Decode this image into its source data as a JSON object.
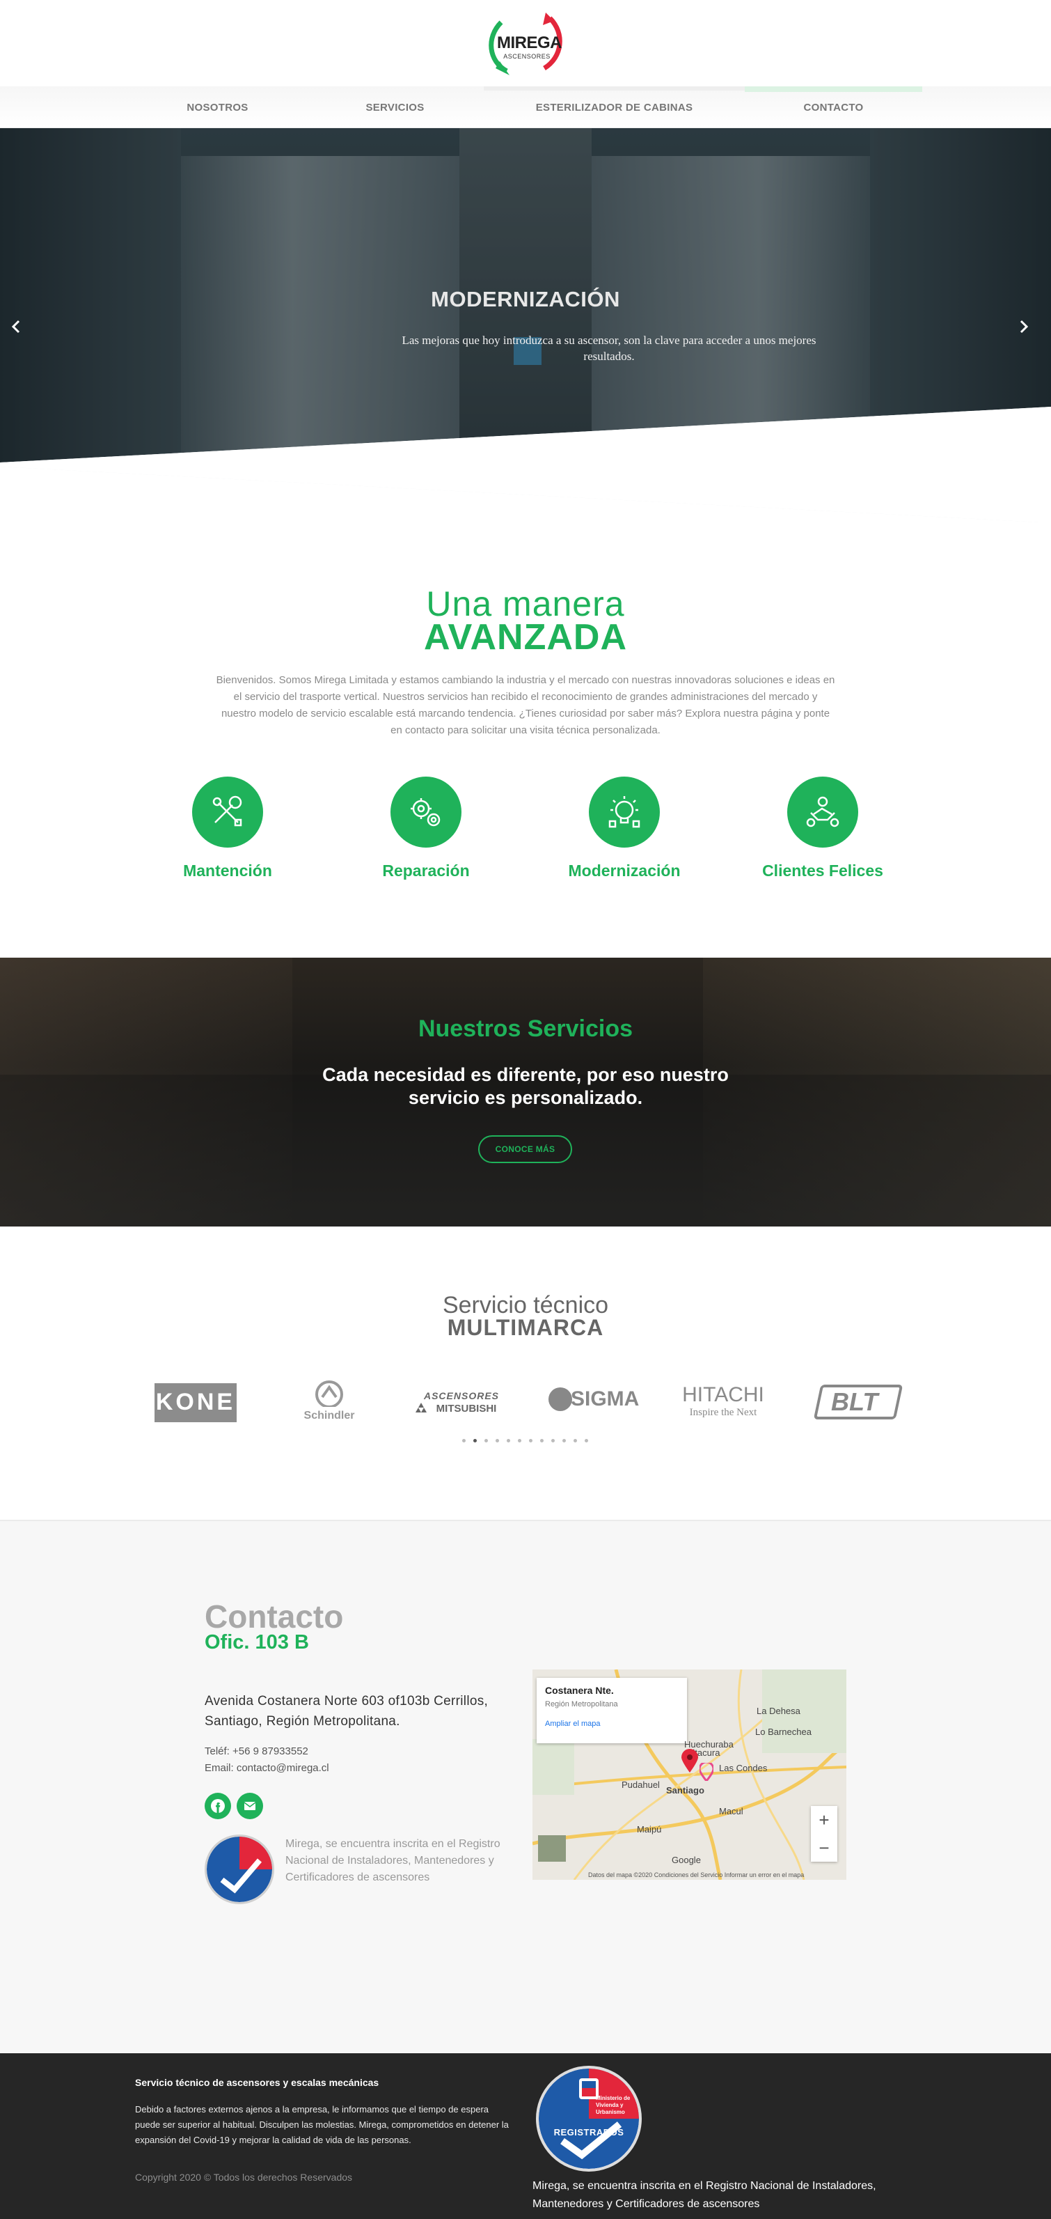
{
  "brand": {
    "name": "MIREGA",
    "tagline": "ASCENSORES",
    "green": "#1fb25a",
    "red": "#e3263b"
  },
  "nav": {
    "items": [
      {
        "label": "NOSOTROS"
      },
      {
        "label": "SERVICIOS"
      },
      {
        "label": "ESTERILIZADOR DE CABINAS"
      },
      {
        "label": "CONTACTO"
      }
    ]
  },
  "hero": {
    "title": "MODERNIZACIÓN",
    "text": "Las mejoras que hoy introduzca a su ascensor, son la clave para acceder a unos mejores resultados.",
    "prev_icon": "chevron-left-icon",
    "next_icon": "chevron-right-icon"
  },
  "intro": {
    "title_light": "Una manera",
    "title_bold": "AVANZADA",
    "paragraph": "Bienvenidos. Somos Mirega Limitada y estamos cambiando la industria y el mercado con nuestras innovadoras soluciones e ideas en el servicio del trasporte vertical. Nuestros servicios han recibido el reconocimiento de grandes administraciones del mercado y nuestro modelo de servicio escalable está marcando tendencia. ¿Tienes curiosidad por saber más? Explora nuestra página y ponte en contacto para solicitar una visita técnica personalizada.",
    "features": [
      {
        "label": "Mantención",
        "icon": "wrench-icon"
      },
      {
        "label": "Reparación",
        "icon": "gears-icon"
      },
      {
        "label": "Modernización",
        "icon": "innovation-icon"
      },
      {
        "label": "Clientes Felices",
        "icon": "handshake-icon"
      }
    ]
  },
  "services": {
    "title": "Nuestros Servicios",
    "subtitle": "Cada necesidad es diferente, por eso nuestro servicio es personalizado.",
    "button": "CONOCE MÁS"
  },
  "brands": {
    "title_light": "Servicio técnico",
    "title_bold": "MULTIMARCA",
    "logos": [
      {
        "text": "KONE"
      },
      {
        "text": "Schindler"
      },
      {
        "text": "ASCENSORES",
        "text2": "MITSUBISHI"
      },
      {
        "text": "SIGMA"
      },
      {
        "text": "HITACHI",
        "text2": "Inspire the Next"
      },
      {
        "text": "BLT"
      }
    ],
    "carousel_pages": 12,
    "carousel_active": 1
  },
  "contact": {
    "title": "Contacto",
    "office": "Ofic. 103 B",
    "address": "Avenida Costanera Norte 603 of103b Cerrillos, Santiago, Región Metropolitana.",
    "phone": "Teléf: +56 9 87933552",
    "email": "Email: contacto@mirega.cl",
    "social": [
      {
        "icon": "facebook-icon"
      },
      {
        "icon": "envelope-icon"
      }
    ],
    "registry": "Mirega, se encuentra inscrita en el Registro Nacional de Instaladores, Mantenedores y Certificadores de ascensores",
    "map": {
      "place": "Costanera Nte.",
      "region": "Región Metropolitana",
      "link": "Ampliar el mapa",
      "labels": [
        "Lo Barnechea",
        "La Dehesa",
        "Las Condes",
        "Vitacura",
        "Huechuraba",
        "Pudahuel",
        "Santiago",
        "Maipú",
        "Macul",
        "Google"
      ],
      "zoom_in": "+",
      "zoom_out": "−",
      "footer": "Datos del mapa ©2020   Condiciones del Servicio   Informar un error en el mapa"
    }
  },
  "badge": {
    "ministry": "Ministerio de Vivienda y Urbanismo",
    "status": "REGISTRADOS"
  },
  "footer": {
    "title": "Servicio técnico de ascensores y escalas mecánicas",
    "text": "Debido a factores externos ajenos a la empresa, le informamos que el tiempo de espera puede ser superior al habitual. Disculpen las molestias. Mirega, comprometidos en detener la expansión del Covid-19 y mejorar la calidad de vida de las personas.",
    "copyright": "Copyright 2020 © Todos los derechos Reservados",
    "registry": "Mirega, se encuentra inscrita en el Registro Nacional de Instaladores, Mantenedores y Certificadores de ascensores"
  }
}
